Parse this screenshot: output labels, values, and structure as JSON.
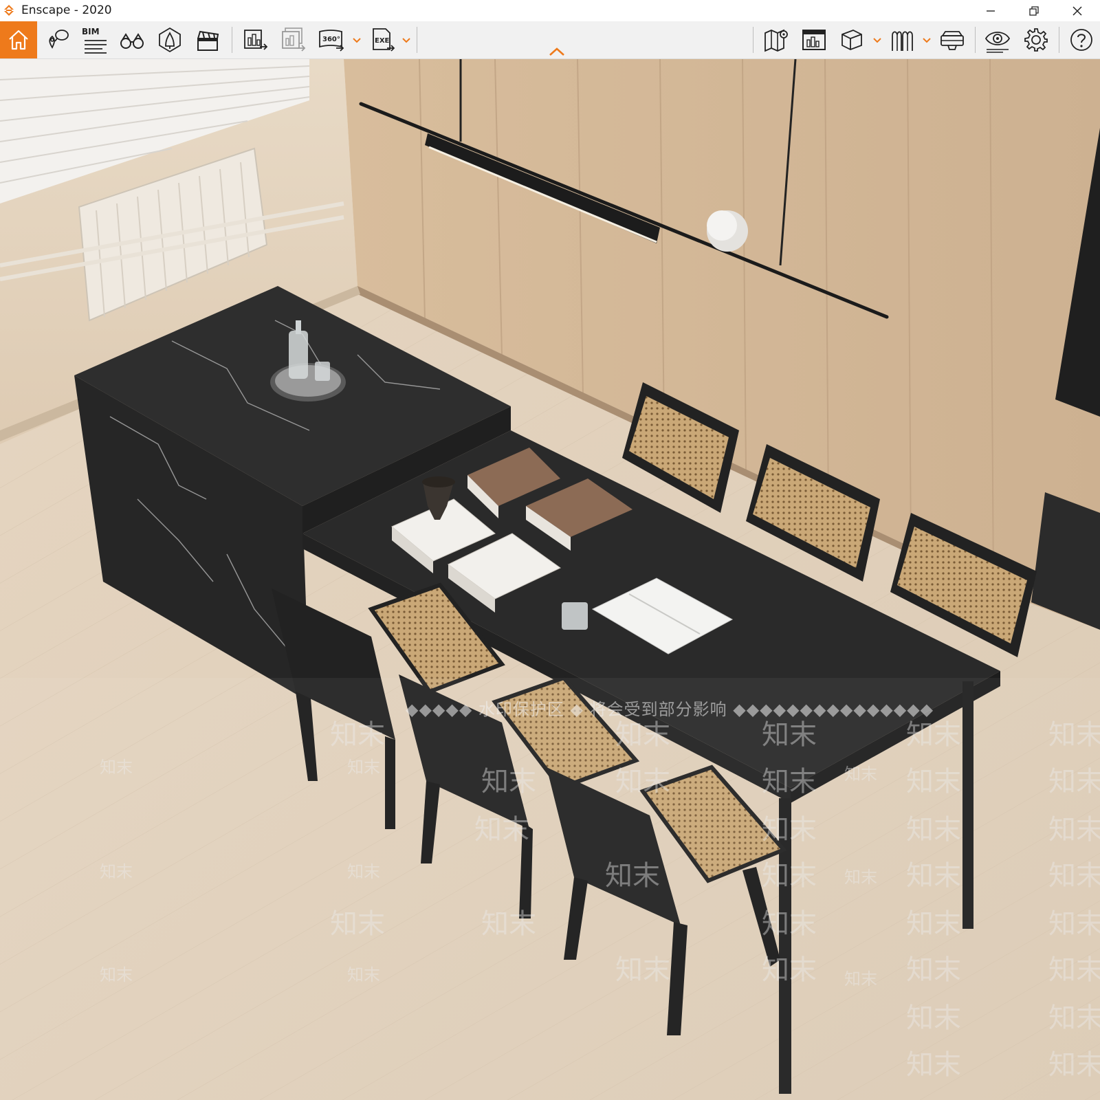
{
  "window": {
    "title": "Enscape - 2020",
    "accent": "#ee7a1b"
  },
  "toolbar": {
    "left_tools": [
      {
        "name": "home-icon",
        "label": ""
      },
      {
        "name": "view-management-icon",
        "label": ""
      },
      {
        "name": "bim-info-icon",
        "label": "BIM"
      },
      {
        "name": "binoculars-icon",
        "label": ""
      },
      {
        "name": "asset-library-icon",
        "label": ""
      },
      {
        "name": "video-editor-icon",
        "label": ""
      },
      {
        "name": "screenshot-icon",
        "label": ""
      },
      {
        "name": "batch-render-icon",
        "label": ""
      },
      {
        "name": "panorama-icon",
        "label": "360°"
      },
      {
        "name": "export-exe-icon",
        "label": "EXE"
      }
    ],
    "right_tools": [
      {
        "name": "map-icon"
      },
      {
        "name": "render-settings-icon"
      },
      {
        "name": "cube-icon"
      },
      {
        "name": "material-editor-icon"
      },
      {
        "name": "vr-headset-icon"
      },
      {
        "name": "visual-settings-icon"
      },
      {
        "name": "gear-icon"
      },
      {
        "name": "help-icon"
      }
    ]
  },
  "watermark": {
    "notice": "◆◆◆◆◆ 水印保护区 ◆ 将会受到部分影响 ◆◆◆◆◆◆◆◆◆◆◆◆◆◆◆",
    "brand": "知末"
  }
}
